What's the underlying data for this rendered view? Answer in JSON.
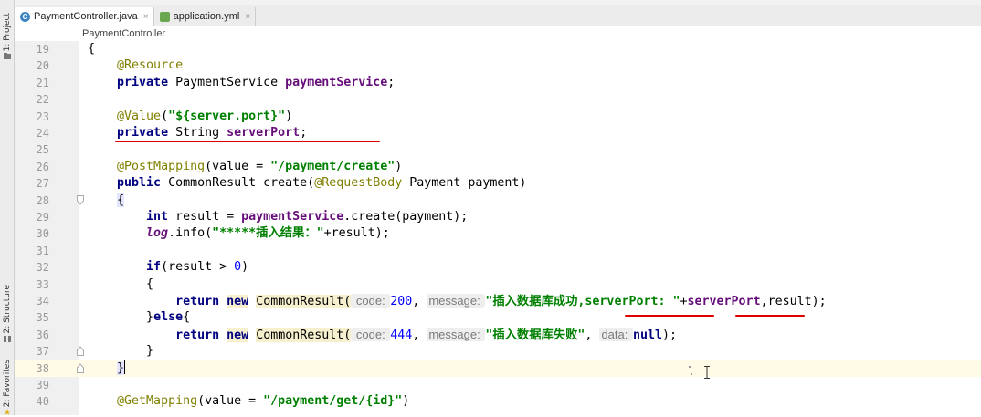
{
  "tabs": [
    {
      "label": "PaymentController.java",
      "type": "java",
      "active": true,
      "close": "×"
    },
    {
      "label": "application.yml",
      "type": "yml",
      "active": false,
      "close": "×"
    }
  ],
  "breadcrumb": "PaymentController",
  "tool_windows": {
    "project": "1: Project",
    "structure": "2: Structure",
    "favorites": "2: Favorites"
  },
  "lines": [
    {
      "n": "19",
      "parts": [
        [
          "",
          "{"
        ]
      ]
    },
    {
      "n": "20",
      "parts": [
        [
          "",
          "    "
        ],
        [
          "ann",
          "@Resource"
        ]
      ]
    },
    {
      "n": "21",
      "parts": [
        [
          "",
          "    "
        ],
        [
          "kw",
          "private"
        ],
        [
          "",
          " PaymentService "
        ],
        [
          "fld",
          "paymentService"
        ],
        [
          "",
          ";"
        ]
      ]
    },
    {
      "n": "22",
      "parts": []
    },
    {
      "n": "23",
      "parts": [
        [
          "",
          "    "
        ],
        [
          "ann",
          "@Value"
        ],
        [
          "",
          "("
        ],
        [
          "str",
          "\"${server.port}\""
        ],
        [
          "",
          ")"
        ]
      ]
    },
    {
      "n": "24",
      "parts": [
        [
          "",
          "    "
        ],
        [
          "kw",
          "private"
        ],
        [
          "",
          " String "
        ],
        [
          "fld",
          "serverPort"
        ],
        [
          "",
          ";"
        ]
      ]
    },
    {
      "n": "25",
      "parts": []
    },
    {
      "n": "26",
      "parts": [
        [
          "",
          "    "
        ],
        [
          "ann",
          "@PostMapping"
        ],
        [
          "",
          "(value = "
        ],
        [
          "str",
          "\"/payment/create\""
        ],
        [
          "",
          ")"
        ]
      ]
    },
    {
      "n": "27",
      "parts": [
        [
          "",
          "    "
        ],
        [
          "kw",
          "public"
        ],
        [
          "",
          " CommonResult create("
        ],
        [
          "ann",
          "@RequestBody"
        ],
        [
          "",
          " Payment payment)"
        ]
      ]
    },
    {
      "n": "28",
      "parts": [
        [
          "",
          "    "
        ],
        [
          "brace",
          "{"
        ]
      ]
    },
    {
      "n": "29",
      "parts": [
        [
          "",
          "        "
        ],
        [
          "kw",
          "int"
        ],
        [
          "",
          " result = "
        ],
        [
          "fld",
          "paymentService"
        ],
        [
          "",
          ".create(payment);"
        ]
      ]
    },
    {
      "n": "30",
      "parts": [
        [
          "",
          "        "
        ],
        [
          "ifld",
          "log"
        ],
        [
          "",
          ".info("
        ],
        [
          "str",
          "\"*****插入结果：\""
        ],
        [
          "",
          "+result);"
        ]
      ]
    },
    {
      "n": "31",
      "parts": []
    },
    {
      "n": "32",
      "parts": [
        [
          "",
          "        "
        ],
        [
          "kw",
          "if"
        ],
        [
          "",
          "(result > "
        ],
        [
          "num",
          "0"
        ],
        [
          "",
          ")"
        ]
      ]
    },
    {
      "n": "33",
      "parts": [
        [
          "",
          "        {"
        ]
      ]
    },
    {
      "n": "34",
      "parts": [
        [
          "",
          "            "
        ],
        [
          "kw",
          "return"
        ],
        [
          "",
          " "
        ],
        [
          "kwhl",
          "new"
        ],
        [
          "",
          " "
        ],
        [
          "hl",
          "CommonResult("
        ],
        [
          "hint",
          " code: "
        ],
        [
          "num",
          "200"
        ],
        [
          "",
          ", "
        ],
        [
          "hint",
          "message: "
        ],
        [
          "str",
          "\"插入数据库成功,serverPort: \""
        ],
        [
          "",
          "+"
        ],
        [
          "fld",
          "serverPort"
        ],
        [
          "",
          ",result);"
        ]
      ]
    },
    {
      "n": "35",
      "parts": [
        [
          "",
          "        }"
        ],
        [
          "kw",
          "else"
        ],
        [
          "",
          "{"
        ]
      ]
    },
    {
      "n": "36",
      "parts": [
        [
          "",
          "            "
        ],
        [
          "kw",
          "return"
        ],
        [
          "",
          " "
        ],
        [
          "kwhl",
          "new"
        ],
        [
          "",
          " "
        ],
        [
          "hl",
          "CommonResult("
        ],
        [
          "hint",
          " code: "
        ],
        [
          "num",
          "444"
        ],
        [
          "",
          ", "
        ],
        [
          "hint",
          "message: "
        ],
        [
          "str",
          "\"插入数据库失败\""
        ],
        [
          "",
          ", "
        ],
        [
          "hint",
          "data: "
        ],
        [
          "kw",
          "null"
        ],
        [
          "",
          ");"
        ]
      ]
    },
    {
      "n": "37",
      "parts": [
        [
          "",
          "        }"
        ]
      ]
    },
    {
      "n": "38",
      "parts": [
        [
          "",
          "    "
        ],
        [
          "brace",
          "}"
        ]
      ],
      "current": true
    },
    {
      "n": "39",
      "parts": []
    },
    {
      "n": "40",
      "parts": [
        [
          "",
          "    "
        ],
        [
          "ann",
          "@GetMapping"
        ],
        [
          "",
          "(value = "
        ],
        [
          "str",
          "\"/payment/get/{id}\""
        ],
        [
          "",
          ")"
        ]
      ]
    }
  ],
  "colors": {
    "keyword": "#000080",
    "annotation": "#808000",
    "string": "#008000",
    "number": "#0000ff",
    "field": "#660e7a",
    "underline": "#e00000"
  }
}
